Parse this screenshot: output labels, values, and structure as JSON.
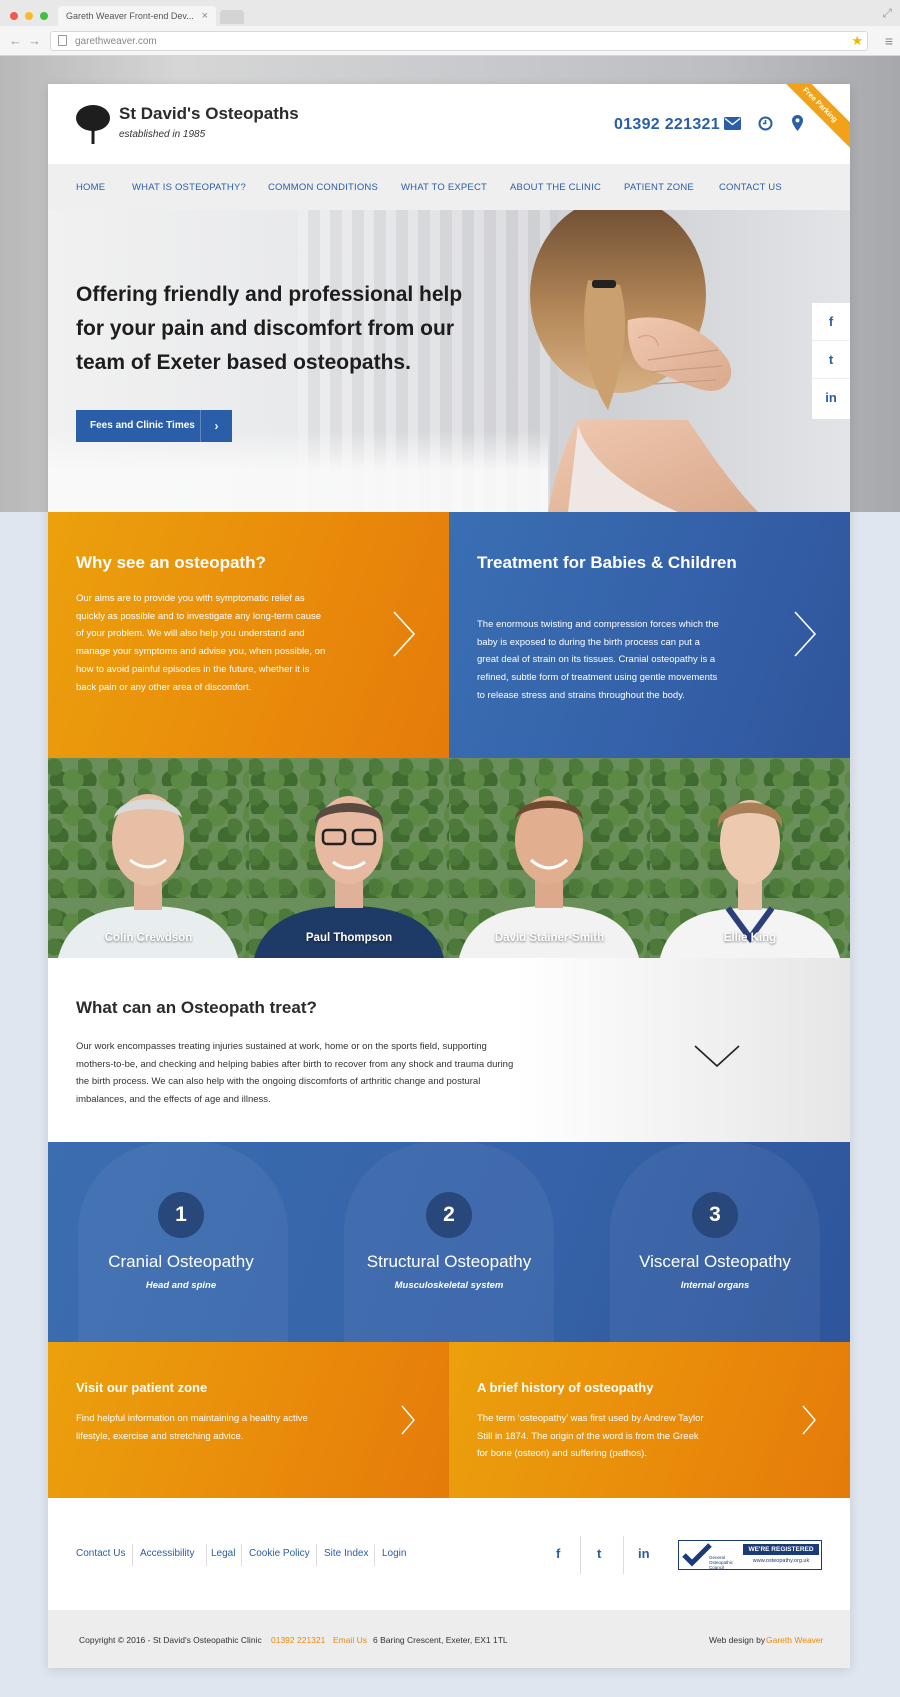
{
  "browser": {
    "tab_title": "Gareth Weaver Front-end Dev...",
    "url": "garethweaver.com"
  },
  "header": {
    "brand": "St David's Osteopaths",
    "tagline": "established in 1985",
    "phone": "01392 221321",
    "ribbon": "Free Parking"
  },
  "nav": {
    "items": [
      "HOME",
      "WHAT IS OSTEOPATHY?",
      "COMMON CONDITIONS",
      "WHAT TO EXPECT",
      "ABOUT THE CLINIC",
      "PATIENT ZONE",
      "CONTACT US"
    ]
  },
  "hero": {
    "title": "Offering friendly and professional help for your pain and discomfort from our team of Exeter based osteopaths.",
    "button": "Fees and Clinic Times"
  },
  "social": [
    "f",
    "t",
    "in"
  ],
  "panels": [
    {
      "title": "Why see an osteopath?",
      "text": "Our aims are to provide you with symptomatic relief as quickly as possible and to investigate any long-term cause of your problem. We will also help you understand and manage your symptoms and advise you, when possible, on how to avoid painful episodes in the future, whether it is back pain or any other area of discomfort."
    },
    {
      "title": "Treatment for Babies & Children",
      "text": "The enormous twisting and compression forces which the baby is exposed to during the birth process can put a great deal of strain on its tissues. Cranial osteopathy is a refined, subtle form of treatment using gentle movements to release stress and strains throughout the body."
    }
  ],
  "team": [
    "Colin Crewdson",
    "Paul Thompson",
    "David Stainer-Smith",
    "Ellie King"
  ],
  "treat": {
    "title": "What can an Osteopath treat?",
    "text": "Our work encompasses treating injuries sustained at work, home or on the sports field, supporting mothers-to-be, and checking and helping babies after birth to recover from any shock and trauma during the birth process. We can also help with the ongoing discomforts of arthritic change and postural imbalances, and the effects of age and illness."
  },
  "types": [
    {
      "num": "1",
      "name": "Cranial Osteopathy",
      "sub": "Head and spine"
    },
    {
      "num": "2",
      "name": "Structural Osteopathy",
      "sub": "Musculoskeletal system"
    },
    {
      "num": "3",
      "name": "Visceral Osteopathy",
      "sub": "Internal organs"
    }
  ],
  "bottom_panels": [
    {
      "title": "Visit our patient zone",
      "text": "Find helpful information on maintaining a healthy active lifestyle, exercise and stretching advice."
    },
    {
      "title": "A brief history of osteopathy",
      "text": "The term ‘osteopathy’ was first used by Andrew Taylor Still in 1874. The origin of the word is from the Greek for bone (osteon) and suffering (pathos)."
    }
  ],
  "footer": {
    "links": [
      "Contact Us",
      "Accessibility",
      "Legal",
      "Cookie Policy",
      "Site Index",
      "Login"
    ],
    "social": [
      "f",
      "t",
      "in"
    ],
    "badge_gen": "General Osteopathic Council",
    "badge_top": "WE'RE REGISTERED",
    "badge_url": "www.osteopathy.org.uk"
  },
  "copyright": {
    "text": "Copyright © 2016 - St David's Osteopathic Clinic",
    "phone": "01392 221321",
    "email": "Email Us",
    "address": "6 Baring Crescent, Exeter, EX1 1TL",
    "credit_prefix": "Web design by",
    "credit_name": "Gareth Weaver"
  },
  "colors": {
    "brand_blue": "#2a5ea8",
    "brand_orange": "#e98a0b"
  }
}
